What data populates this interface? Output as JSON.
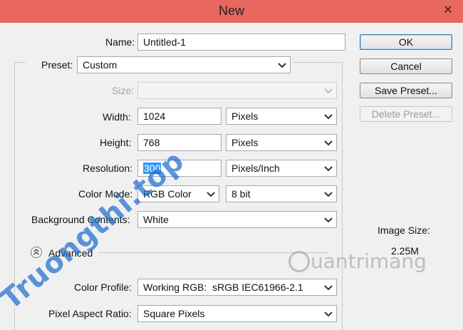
{
  "window": {
    "title": "New",
    "close_glyph": "✕"
  },
  "name": {
    "label": "Name:",
    "value": "Untitled-1"
  },
  "preset": {
    "label": "Preset:",
    "value": "Custom"
  },
  "size": {
    "label": "Size:",
    "value": ""
  },
  "width": {
    "label": "Width:",
    "value": "1024",
    "unit": "Pixels"
  },
  "height": {
    "label": "Height:",
    "value": "768",
    "unit": "Pixels"
  },
  "resolution": {
    "label": "Resolution:",
    "value": "300",
    "unit": "Pixels/Inch"
  },
  "color_mode": {
    "label": "Color Mode:",
    "mode": "RGB Color",
    "depth": "8 bit"
  },
  "background": {
    "label": "Background Contents:",
    "value": "White"
  },
  "advanced": {
    "label": "Advanced"
  },
  "color_profile": {
    "label": "Color Profile:",
    "value": "Working RGB:  sRGB IEC61966-2.1"
  },
  "pixel_aspect": {
    "label": "Pixel Aspect Ratio:",
    "value": "Square Pixels"
  },
  "buttons": {
    "ok": "OK",
    "cancel": "Cancel",
    "save_preset": "Save Preset...",
    "delete_preset": "Delete Preset..."
  },
  "image_size": {
    "label": "Image Size:",
    "value": "2.25M"
  },
  "watermarks": {
    "left": "Truongthi.top",
    "right": "uantrimang"
  },
  "colors": {
    "titlebar": "#e8675f",
    "selection": "#3399ff",
    "watermark_blue": "#1e6ecd"
  },
  "icons": {
    "dropdown": "chevron-down-icon",
    "advanced": "collapse-circle-icon",
    "close": "close-icon"
  }
}
